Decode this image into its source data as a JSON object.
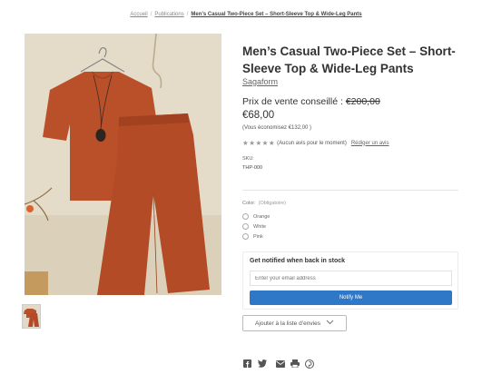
{
  "breadcrumb": {
    "items": [
      "Accueil",
      "Publications"
    ],
    "current": "Men’s Casual Two-Piece Set – Short-Sleeve Top & Wide-Leg Pants"
  },
  "product": {
    "title": "Men’s Casual Two-Piece Set – Short-Sleeve Top & Wide-Leg Pants",
    "brand": "Sagaform",
    "rrp_label": "Prix de vente conseillé :",
    "rrp_value": "€200,00",
    "price": "€68,00",
    "savings": "(Vous économisez €132,00 )",
    "rating": {
      "stars": 5,
      "filled": 0,
      "text": "(Aucun avis pour le moment)",
      "review_link": "Rédiger un avis"
    },
    "sku_label": "SKU:",
    "sku_value": "THP-000"
  },
  "options": {
    "label": "Color:",
    "required": "(Obligatoire)",
    "choices": [
      "Orange",
      "White",
      "Pink"
    ]
  },
  "notify": {
    "title": "Get notified when back in stock",
    "placeholder": "Enter your email address",
    "button": "Notify Me"
  },
  "wishlist": {
    "label": "Ajouter à la liste d’envies"
  },
  "share": {
    "icons": [
      "facebook-icon",
      "twitter-icon",
      "email-icon",
      "print-icon",
      "pinterest-icon"
    ]
  },
  "colors": {
    "accent": "#2f78c7",
    "product": "#b9502a",
    "background": "#ffffff"
  }
}
